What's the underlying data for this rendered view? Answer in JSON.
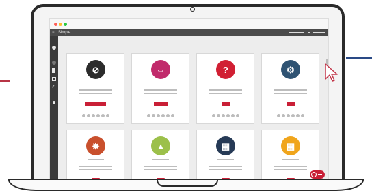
{
  "app": {
    "title": "Simple"
  },
  "colors": {
    "accent_red": "#c91f36",
    "window_dots": [
      "#ff5f57",
      "#febc2e",
      "#28c840"
    ],
    "app_bar": "#4b4b4b",
    "sidebar": "#3a3a3a"
  },
  "sidebar": {
    "items": [
      {
        "icon": "home-icon"
      },
      {
        "icon": "clock-icon"
      },
      {
        "icon": "page-icon"
      },
      {
        "icon": "grid-icon"
      },
      {
        "icon": "check-icon"
      },
      {
        "icon": "user-icon"
      }
    ]
  },
  "cards": [
    {
      "icon": "no-leaf-icon",
      "icon_color": "#2c2c2c",
      "glyph": "⊘",
      "row": 1
    },
    {
      "icon": "flag-icon",
      "icon_color": "#c12a6b",
      "glyph": "⇔",
      "row": 1
    },
    {
      "icon": "question-icon",
      "icon_color": "#d11f33",
      "glyph": "?",
      "row": 1
    },
    {
      "icon": "gear-icon",
      "icon_color": "#2f5373",
      "glyph": "⚙",
      "row": 1
    },
    {
      "icon": "wheel-icon",
      "icon_color": "#c9502d",
      "glyph": "✸",
      "row": 2
    },
    {
      "icon": "cow-icon",
      "icon_color": "#9cc04a",
      "glyph": "▲",
      "row": 2
    },
    {
      "icon": "grid-color-icon",
      "icon_color": "#263a56",
      "glyph": "▦",
      "row": 2
    },
    {
      "icon": "blocks-icon",
      "icon_color": "#f0a51c",
      "glyph": "▦",
      "row": 2
    }
  ],
  "share_icons": [
    "share-icon",
    "comment-icon",
    "like-icon",
    "heart-icon",
    "bookmark-icon",
    "plus-icon"
  ]
}
